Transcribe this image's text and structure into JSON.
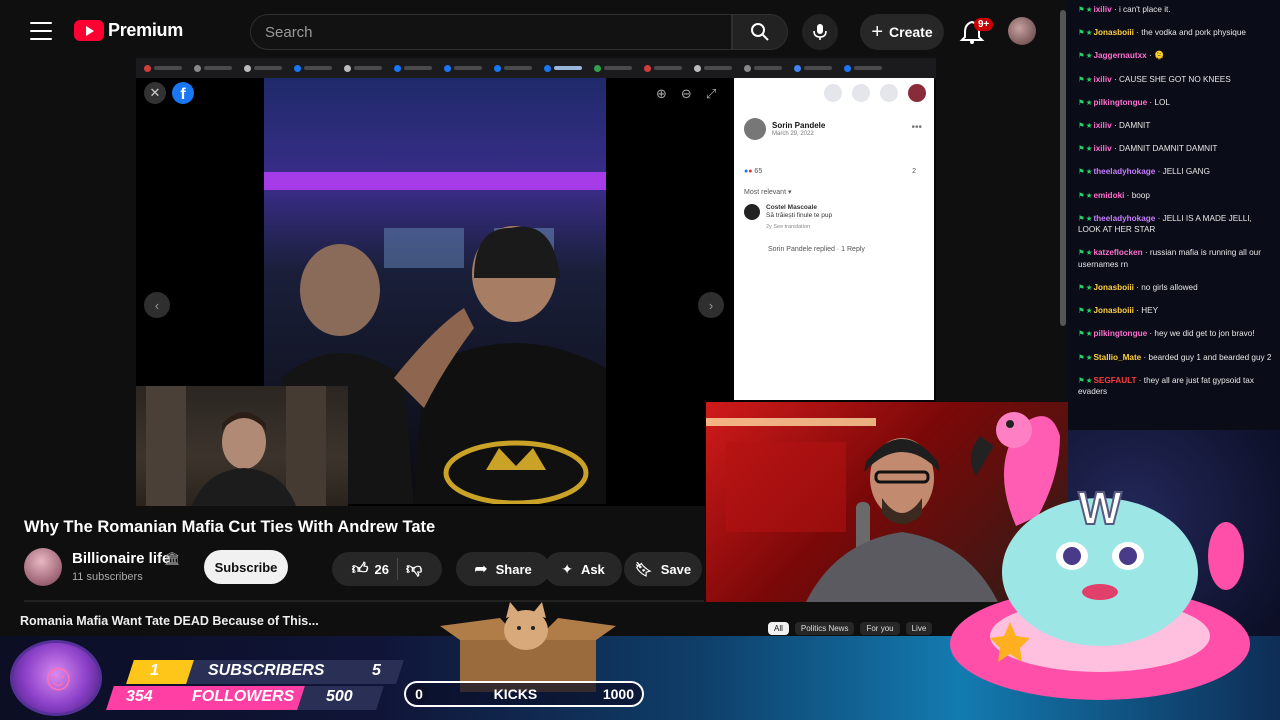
{
  "header": {
    "logo_text": "Premium",
    "search_placeholder": "Search",
    "create_label": "Create",
    "notification_count": "9+"
  },
  "browser_tabs": [
    {
      "color": "#d43c3c"
    },
    {
      "color": "#888888"
    },
    {
      "color": "#bbbbbb"
    },
    {
      "color": "#1877f2"
    },
    {
      "color": "#bbbbbb"
    },
    {
      "color": "#1877f2"
    },
    {
      "color": "#1877f2"
    },
    {
      "color": "#1877f2"
    },
    {
      "color": "#1877f2",
      "active": true
    },
    {
      "color": "#30a14e"
    },
    {
      "color": "#d43c3c"
    },
    {
      "color": "#bbbbbb"
    },
    {
      "color": "#888888"
    },
    {
      "color": "#4285f4"
    },
    {
      "color": "#1877f2"
    }
  ],
  "facebook_post": {
    "author": "Sorin Pandele",
    "date": "March 29, 2022",
    "reactions": "65",
    "comments_count": "2",
    "sort_label": "Most relevant",
    "comment_author": "Costel Mascoale",
    "comment_text": "Să trăiești finule te pup",
    "comment_meta": "2y   See translation",
    "reply_text": "Sorin Pandele replied · 1 Reply"
  },
  "video": {
    "title": "Why The Romanian Mafia Cut Ties With Andrew Tate",
    "channel_name": "Billionaire life",
    "subscribers": "11 subscribers",
    "subscribe_label": "Subscribe",
    "likes": "26",
    "share_label": "Share",
    "ask_label": "Ask",
    "save_label": "Save",
    "next_title": "Romania Mafia Want Tate DEAD Because of This..."
  },
  "chips": [
    "All",
    "Politics News",
    "For you",
    "Live"
  ],
  "chat": [
    {
      "user": "ixiliv",
      "color": "#ff6fcf",
      "text": "i can't place it."
    },
    {
      "user": "Jonasboiii",
      "color": "#ffcf3d",
      "text": "the vodka and pork physique"
    },
    {
      "user": "Jaggernautxx",
      "color": "#ff6fcf",
      "text": "🫠"
    },
    {
      "user": "ixiliv",
      "color": "#ff6fcf",
      "text": "CAUSE SHE GOT NO KNEES"
    },
    {
      "user": "pilkingtongue",
      "color": "#ff6fcf",
      "text": "LOL"
    },
    {
      "user": "ixiliv",
      "color": "#ff6fcf",
      "text": "DAMNIT"
    },
    {
      "user": "ixiliv",
      "color": "#ff6fcf",
      "text": "DAMNIT DAMNIT DAMNIT"
    },
    {
      "user": "theeladyhokage",
      "color": "#c77dff",
      "text": "JELLI GANG"
    },
    {
      "user": "emidoki",
      "color": "#ff6fcf",
      "text": "boop"
    },
    {
      "user": "theeladyhokage",
      "color": "#c77dff",
      "text": "JELLI IS A MADE JELLI, LOOK AT HER STAR"
    },
    {
      "user": "katzeflocken",
      "color": "#ff6fcf",
      "text": "russian mafia is running all our usernames rn"
    },
    {
      "user": "Jonasboiii",
      "color": "#ffcf3d",
      "text": "no girls allowed"
    },
    {
      "user": "Jonasboiii",
      "color": "#ffcf3d",
      "text": "HEY"
    },
    {
      "user": "pilkingtongue",
      "color": "#ff6fcf",
      "text": "hey we did get to jon bravo!"
    },
    {
      "user": "Stallio_Mate",
      "color": "#ffcf3d",
      "text": "bearded guy 1 and bearded guy 2"
    },
    {
      "user": "SEGFAULT",
      "color": "#ff3b3b",
      "text": "they all are just fat gypsoid tax evaders"
    }
  ],
  "overlay": {
    "subs_current": "1",
    "subs_label": "SUBSCRIBERS",
    "subs_goal": "5",
    "followers_current": "354",
    "followers_label": "FOLLOWERS",
    "followers_goal": "500",
    "kicks_current": "0",
    "kicks_label": "KICKS",
    "kicks_goal": "1000"
  },
  "colors": {
    "youtube_red": "#ff0033",
    "subs_bar": "#ffc61a",
    "followers_bar": "#ff3fa4",
    "facebook_blue": "#1877f2"
  }
}
